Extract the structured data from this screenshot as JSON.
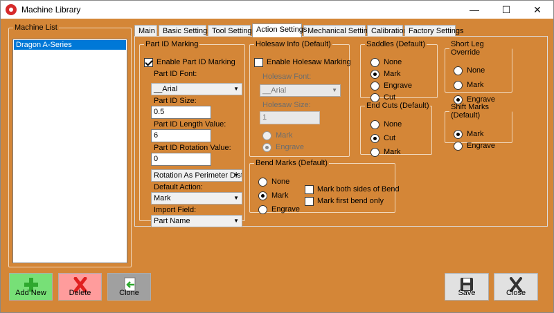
{
  "window": {
    "title": "Machine Library",
    "min": "—",
    "max": "☐",
    "close": "✕"
  },
  "machine_list": {
    "legend": "Machine List",
    "items": [
      "Dragon A-Series"
    ]
  },
  "tabs": [
    "Main",
    "Basic Settings",
    "Tool Settings",
    "Action Settings",
    "Mechanical Settings",
    "Calibration",
    "Factory Settings"
  ],
  "part_id": {
    "legend": "Part ID Marking",
    "enable_label": "Enable Part ID Marking",
    "font_label": "Part ID Font:",
    "font_value": "__Arial",
    "size_label": "Part ID Size:",
    "size_value": "0.5",
    "length_label": "Part ID Length Value:",
    "length_value": "6",
    "rotation_label": "Part ID Rotation Value:",
    "rotation_value": "0",
    "rotation_mode": "Rotation As Perimeter Dista",
    "default_action_label": "Default Action:",
    "default_action_value": "Mark",
    "import_field_label": "Import Field:",
    "import_field_value": "Part Name"
  },
  "holesaw": {
    "legend": "Holesaw Info (Default)",
    "enable_label": "Enable Holesaw Marking",
    "font_label": "Holesaw Font:",
    "font_value": "__Arial",
    "size_label": "Holesaw Size:",
    "size_value": "1",
    "mark": "Mark",
    "engrave": "Engrave"
  },
  "saddles": {
    "legend": "Saddles (Default)",
    "options": [
      "None",
      "Mark",
      "Engrave",
      "Cut"
    ]
  },
  "short_leg": {
    "legend": "Short Leg Override",
    "options": [
      "None",
      "Mark",
      "Engrave"
    ]
  },
  "end_cuts": {
    "legend": "End Cuts (Default)",
    "options": [
      "None",
      "Cut",
      "Mark"
    ]
  },
  "shift_marks": {
    "legend": "Shift Marks (Default)",
    "options": [
      "Mark",
      "Engrave"
    ]
  },
  "bend_marks": {
    "legend": "Bend Marks (Default)",
    "options": [
      "None",
      "Mark",
      "Engrave"
    ],
    "both_sides": "Mark both sides of Bend",
    "first_only": "Mark first bend only"
  },
  "buttons": {
    "add_new": "Add New",
    "delete": "Delete",
    "clone": "Clone",
    "save": "Save",
    "close": "Close"
  },
  "colors": {
    "background": "#d48637",
    "selection": "#0078d7",
    "add_new": "#77e077",
    "delete": "#ff9c9c",
    "clone": "#a0a0a0"
  }
}
